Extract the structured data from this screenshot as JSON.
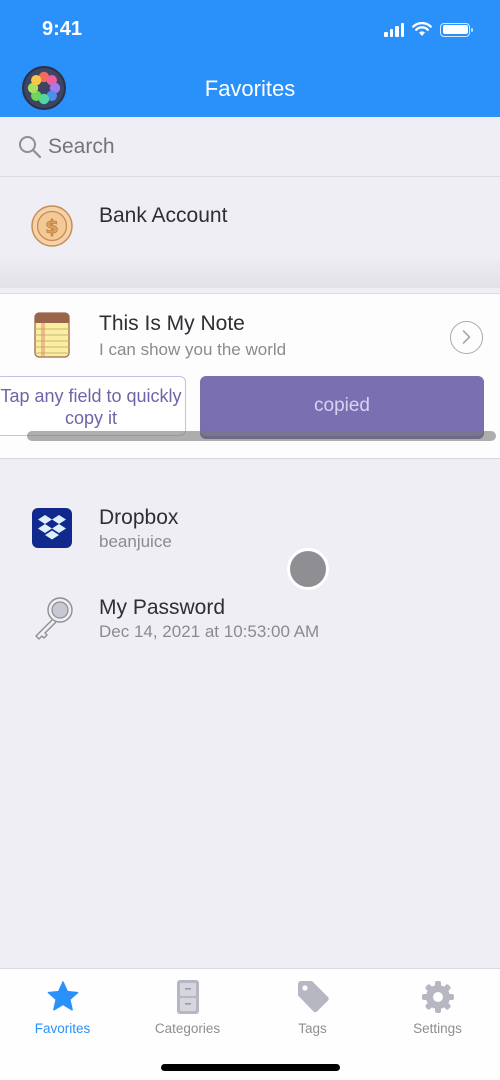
{
  "status_bar": {
    "time": "9:41",
    "icons": [
      "cellular-signal-icon",
      "wifi-icon",
      "battery-icon"
    ]
  },
  "nav": {
    "title": "Favorites",
    "logo_icon": "app-logo-icon"
  },
  "search": {
    "placeholder": "Search",
    "icon": "search-icon"
  },
  "items": [
    {
      "title": "Bank Account",
      "subtitle": "",
      "icon": "coin-dollar-icon"
    },
    {
      "title": "This Is My Note",
      "subtitle": "I can show you the world",
      "icon": "notepad-icon",
      "expanded": true
    },
    {
      "title": "Dropbox",
      "subtitle": "beanjuice",
      "icon": "dropbox-icon"
    },
    {
      "title": "My Password",
      "subtitle": "Dec 14, 2021 at 10:53:00 AM",
      "icon": "key-icon"
    }
  ],
  "note_card": {
    "hint": "Tap any field to quickly copy it",
    "copied_label": "copied",
    "chevron_icon": "chevron-right-circle-icon"
  },
  "tabs": [
    {
      "label": "Favorites",
      "icon": "star-icon",
      "active": true
    },
    {
      "label": "Categories",
      "icon": "filing-cabinet-icon",
      "active": false
    },
    {
      "label": "Tags",
      "icon": "tag-icon",
      "active": false
    },
    {
      "label": "Settings",
      "icon": "gear-icon",
      "active": false
    }
  ],
  "colors": {
    "brand_blue": "#2a91fb",
    "accent_purple": "#7a6fb1",
    "background": "#efeef4",
    "inactive_tab": "#8e8e93"
  }
}
